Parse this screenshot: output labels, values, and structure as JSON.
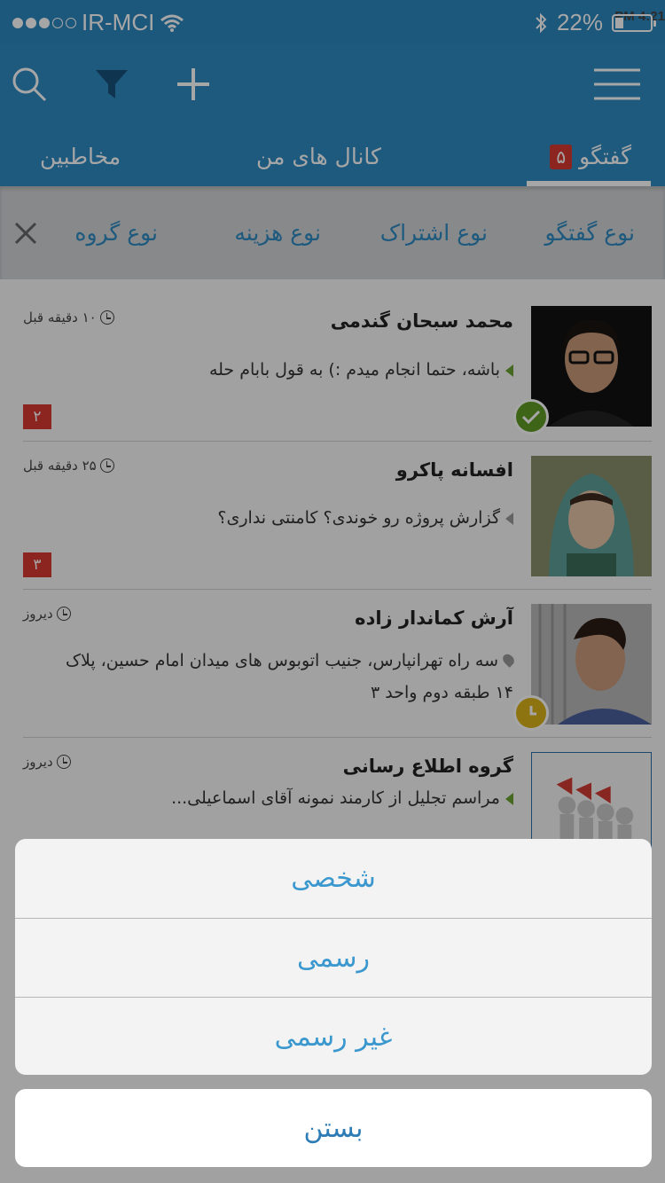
{
  "status_bar": {
    "carrier": "IR-MCI",
    "time": "4:21 PM",
    "battery": "22%"
  },
  "header": {
    "tabs": [
      {
        "label": "گفتگو",
        "badge": "۵"
      },
      {
        "label": "کانال های من"
      },
      {
        "label": "مخاطبین"
      }
    ],
    "active_tab": "گفتگو"
  },
  "filter_bar": {
    "items": [
      "نوع گفتگو",
      "نوع اشتراک",
      "نوع هزینه",
      "نوع گروه"
    ]
  },
  "conversations": [
    {
      "name": "محمد سبحان گندمی",
      "time": "۱۰ دقیقه قبل",
      "message": "باشه، حتما انجام میدم :) به قول بابام حله",
      "unread": "۲",
      "presence": "delivered"
    },
    {
      "name": "افسانه پاکرو",
      "time": "۲۵ دقیقه قبل",
      "message": "گزارش پروژه رو خوندی؟ کامنتی نداری؟",
      "unread": "۳"
    },
    {
      "name": "آرش کماندار زاده",
      "time": "دیروز",
      "message": "سه راه تهرانپارس، جنیب اتوبوس های میدان امام حسین، پلاک ۱۴ طبقه دوم واحد ۳",
      "presence": "pending"
    },
    {
      "name": "گروه اطلاع رسانی",
      "time": "دیروز",
      "message": "مراسم تجلیل از کارمند نمونه آقای اسماعیلی..."
    }
  ],
  "action_sheet": {
    "options": [
      "شخصی",
      "رسمی",
      "غیر رسمی"
    ],
    "cancel": "بستن"
  },
  "colors": {
    "primary": "#2e89c2",
    "badge": "#d73a32",
    "accent_green": "#5f9a24",
    "accent_yellow": "#d9b21a"
  }
}
